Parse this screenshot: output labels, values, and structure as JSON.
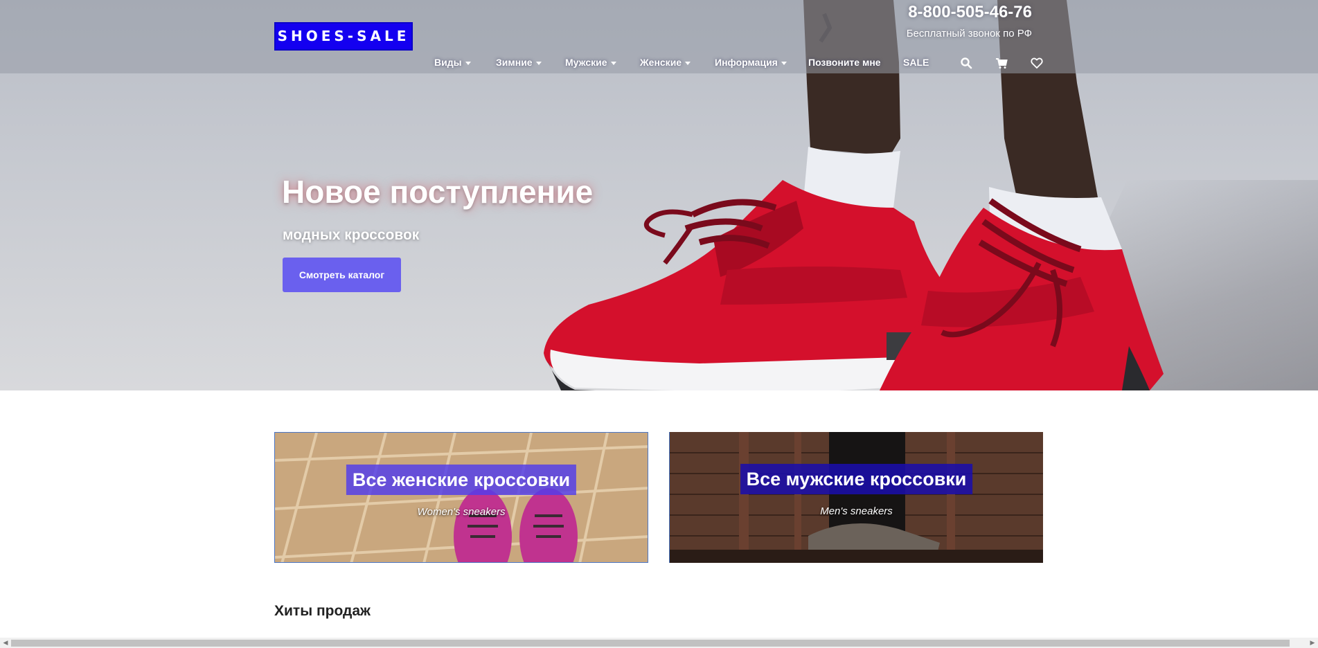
{
  "header": {
    "logo": "SHOES-SALE",
    "phone": "8-800-505-46-76",
    "phone_note": "Бесплатный звонок по РФ"
  },
  "nav": {
    "items": [
      {
        "label": "Виды",
        "dropdown": true
      },
      {
        "label": "Зимние",
        "dropdown": true
      },
      {
        "label": "Мужские",
        "dropdown": true
      },
      {
        "label": "Женские",
        "dropdown": true
      },
      {
        "label": "Информация",
        "dropdown": true
      },
      {
        "label": "Позвоните мне",
        "dropdown": false
      },
      {
        "label": "SALE",
        "dropdown": false
      }
    ],
    "icons": [
      "search-icon",
      "cart-icon",
      "heart-icon"
    ]
  },
  "hero": {
    "title": "Новое поступление",
    "subtitle": "модных кроссовок",
    "button": "Смотреть каталог"
  },
  "categories": [
    {
      "title": "Все женские кроссовки",
      "subtitle": "Women's sneakers"
    },
    {
      "title": "Все мужские кроссовки",
      "subtitle": "Men's sneakers"
    }
  ],
  "sections": {
    "bestsellers_title": "Хиты продаж"
  },
  "colors": {
    "logo_bg": "#1400f0",
    "button_bg": "#6a60ee",
    "shoe_red": "#d4102c"
  }
}
